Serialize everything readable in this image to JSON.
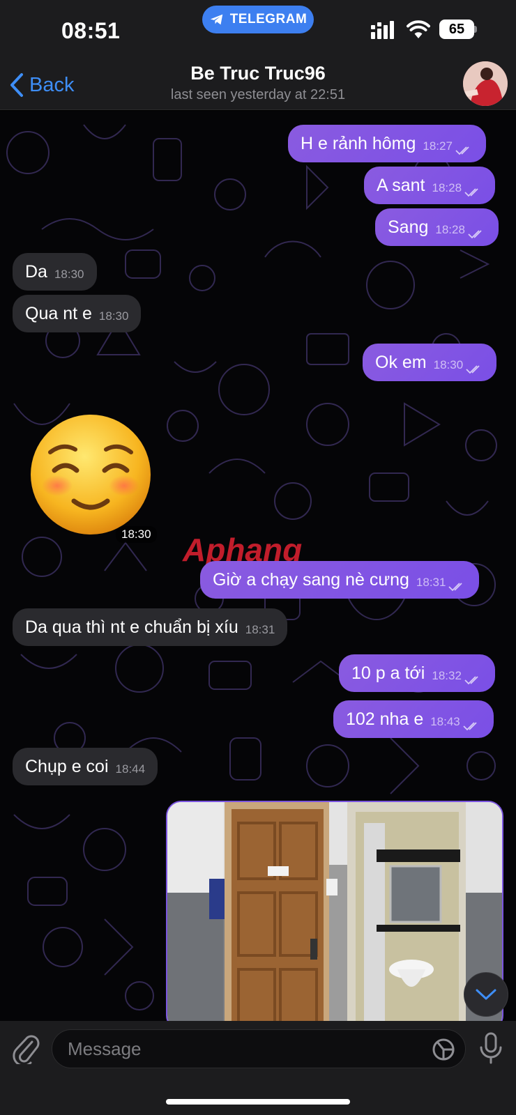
{
  "status_bar": {
    "time": "08:51",
    "app_pill": "TELEGRAM",
    "battery": "65"
  },
  "header": {
    "back_label": "Back",
    "title": "Be Truc Truc96",
    "subtitle": "last seen yesterday at 22:51"
  },
  "messages": [
    {
      "dir": "out",
      "text": "H e rảnh hômg",
      "time": "18:27"
    },
    {
      "dir": "out",
      "text": "A sant",
      "time": "18:28"
    },
    {
      "dir": "out",
      "text": "Sang",
      "time": "18:28"
    },
    {
      "dir": "in",
      "text": "Da",
      "time": "18:30"
    },
    {
      "dir": "in",
      "text": "Qua nt e",
      "time": "18:30"
    },
    {
      "dir": "out",
      "text": "Ok em",
      "time": "18:30"
    },
    {
      "dir": "in",
      "text": "☺️",
      "time": "18:30"
    },
    {
      "dir": "out",
      "text": "Giờ a chạy sang nè cưng",
      "time": "18:31"
    },
    {
      "dir": "in",
      "text": "Da qua thì nt e chuẩn bị xíu",
      "time": "18:31"
    },
    {
      "dir": "out",
      "text": "10 p a tới",
      "time": "18:32"
    },
    {
      "dir": "out",
      "text": "102 nha e",
      "time": "18:43"
    },
    {
      "dir": "in",
      "text": "Chụp e coi",
      "time": "18:44"
    }
  ],
  "watermark": "Aphang",
  "input": {
    "placeholder": "Message"
  },
  "colors": {
    "outgoing_bubble": "#8255e3",
    "incoming_bubble": "#2a2a2e",
    "accent": "#3e8ef7",
    "pill": "#3d7ff0"
  }
}
